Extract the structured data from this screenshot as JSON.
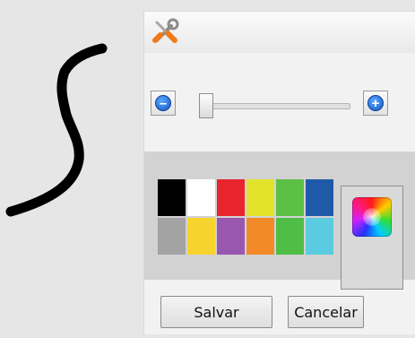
{
  "colors": {
    "panel_background": "#f2f2f2",
    "palette_background": "#d2d2d2",
    "desktop_background": "#e6e6e6",
    "stroke": "#000000"
  },
  "icons": {
    "titlebar": "tools-icon",
    "zoom_out": "minus-circle-icon",
    "zoom_in": "plus-circle-icon",
    "custom_color": "color-wheel-icon"
  },
  "palette": {
    "row1": [
      "#000000",
      "#ffffff",
      "#e8242c",
      "#e3e32b",
      "#5cc044",
      "#1f5aa8"
    ],
    "row2": [
      "#a3a3a3",
      "#f7d32d",
      "#9a57b0",
      "#f38a2a",
      "#4fbe47",
      "#5acbe0"
    ]
  },
  "buttons": {
    "save_label": "Salvar",
    "cancel_label": "Cancelar"
  }
}
